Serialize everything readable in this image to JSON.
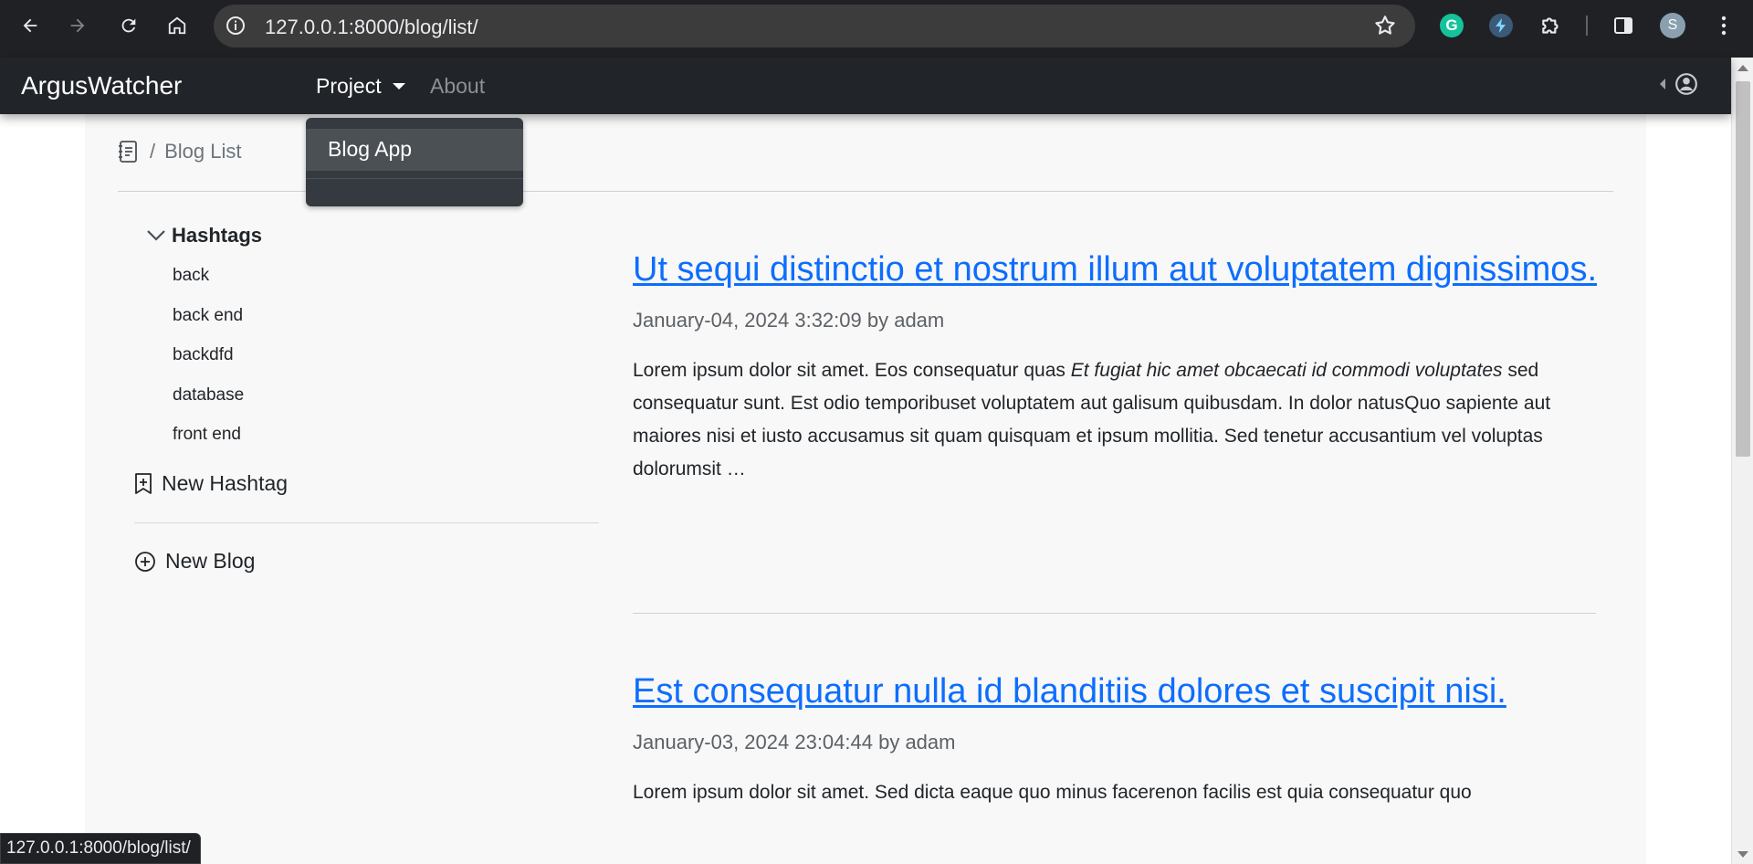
{
  "browser": {
    "url": "127.0.0.1:8000/blog/list/",
    "profile_initial": "S",
    "grammarly_letter": "G"
  },
  "navbar": {
    "brand": "ArgusWatcher",
    "project_label": "Project",
    "about_label": "About"
  },
  "dropdown": {
    "items": [
      {
        "label": "Blog App"
      }
    ]
  },
  "breadcrumb": {
    "separator": "/",
    "current": "Blog List"
  },
  "sidebar": {
    "hashtags_heading": "Hashtags",
    "tags": [
      "back",
      "back end",
      "backdfd",
      "database",
      "front end"
    ],
    "new_hashtag_label": "New Hashtag",
    "new_blog_label": "New Blog"
  },
  "posts": [
    {
      "title": "Ut sequi distinctio et nostrum illum aut voluptatem dignissimos.",
      "meta": "January-04, 2024 3:32:09 by adam",
      "excerpt_before": "Lorem ipsum dolor sit amet. Eos consequatur quas ",
      "excerpt_italic": "Et fugiat hic amet obcaecati id commodi voluptates",
      "excerpt_after": " sed consequatur sunt. Est odio temporibuset voluptatem aut galisum quibusdam. In dolor natusQuo sapiente aut maiores nisi et iusto accusamus sit quam quisquam et ipsum mollitia. Sed tenetur accusantium vel voluptas dolorumsit …"
    },
    {
      "title": "Est consequatur nulla id blanditiis dolores et suscipit nisi.",
      "meta": "January-03, 2024 23:04:44 by adam",
      "excerpt_before": "Lorem ipsum dolor sit amet. Sed dicta eaque quo minus facerenon facilis est quia consequatur quo",
      "excerpt_italic": "",
      "excerpt_after": ""
    }
  ],
  "statusbar": {
    "text": "127.0.0.1:8000/blog/list/"
  },
  "colors": {
    "link": "#0d6efd",
    "navbar_bg": "#212529",
    "dropdown_bg": "#343a40"
  }
}
